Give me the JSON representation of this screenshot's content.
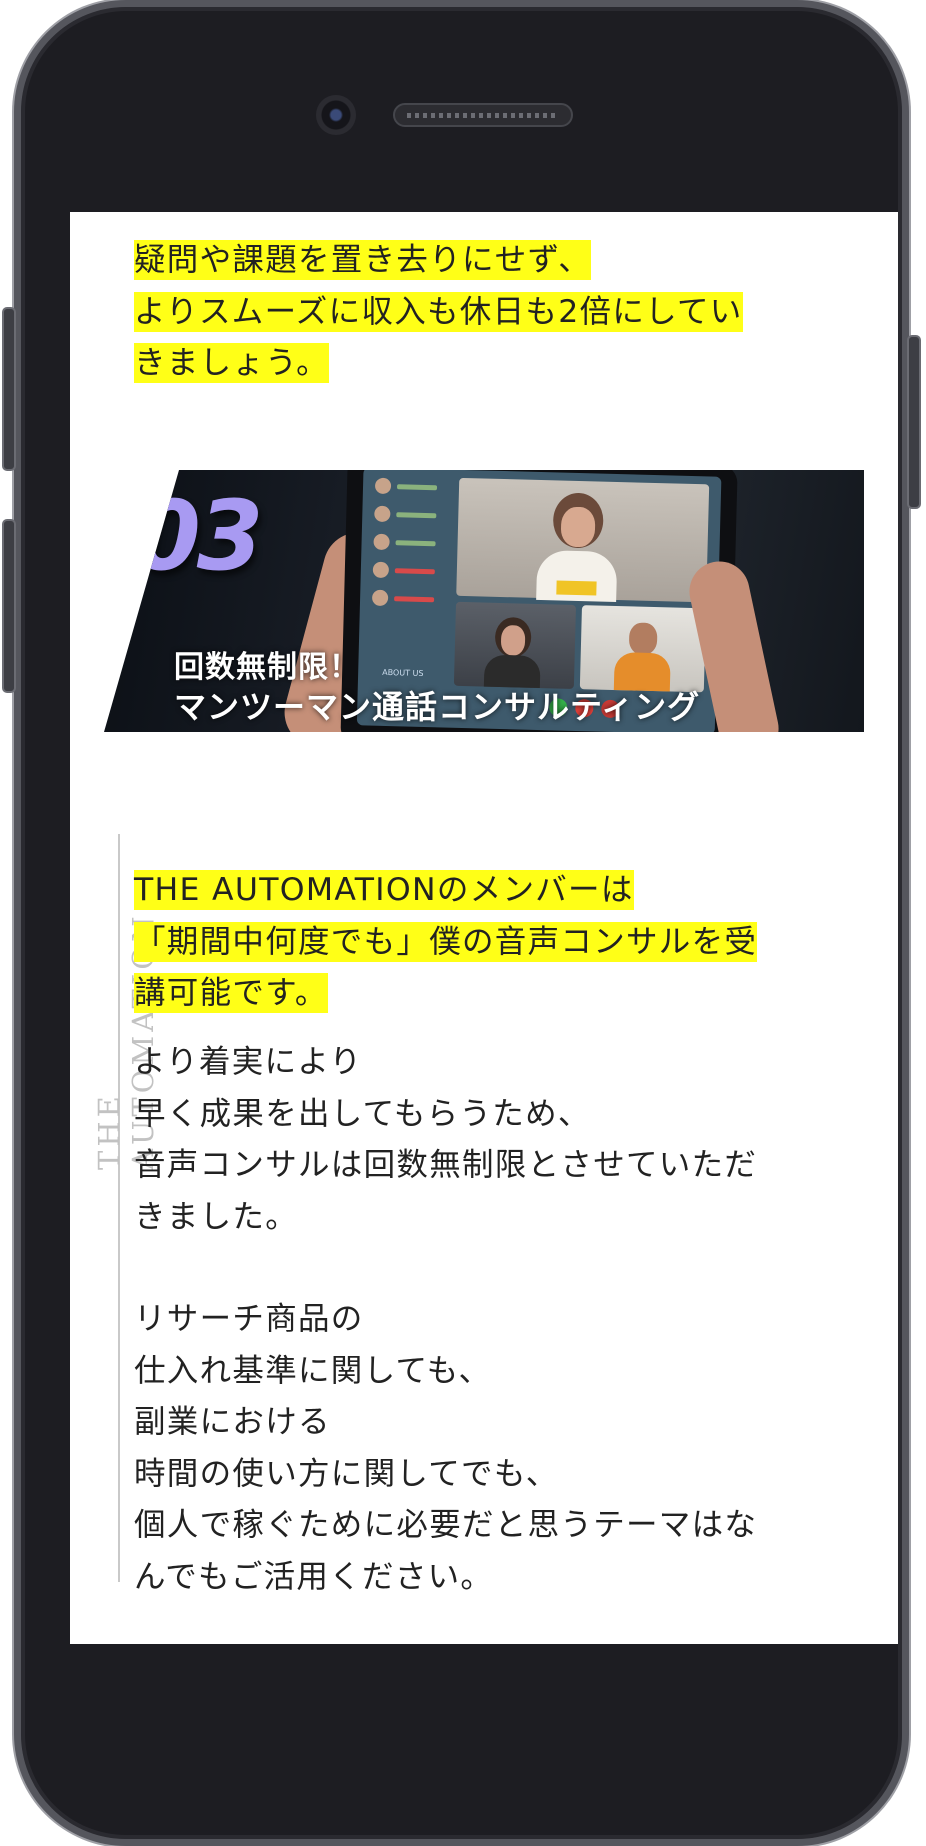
{
  "intro": {
    "lines": [
      "疑問や課題を置き去りにせず、",
      "よりスムーズに収入も休日も2倍にしてい",
      "きましょう。"
    ]
  },
  "banner": {
    "number": "03",
    "subtitle": "回数無制限！",
    "title": "マンツーマン通話コンサルティング",
    "contact_button": "ABOUT US"
  },
  "side_label": "THE AUTOMATION",
  "highlight2": {
    "lines": [
      "THE AUTOMATIONのメンバーは",
      "「期間中何度でも」僕の音声コンサルを受",
      "講可能です。"
    ]
  },
  "body1": {
    "lines": [
      "より着実により",
      "早く成果を出してもらうため、",
      "音声コンサルは回数無制限とさせていただ",
      "きました。"
    ]
  },
  "body2": {
    "lines": [
      "リサーチ商品の",
      "仕入れ基準に関しても、",
      "副業における",
      "時間の使い方に関してでも、",
      "個人で稼ぐために必要だと思うテーマはな",
      "んでもご活用ください。"
    ]
  },
  "colors": {
    "highlight": "#ffff17",
    "accent": "#a89af2",
    "phone_body": "#1d1d22"
  }
}
